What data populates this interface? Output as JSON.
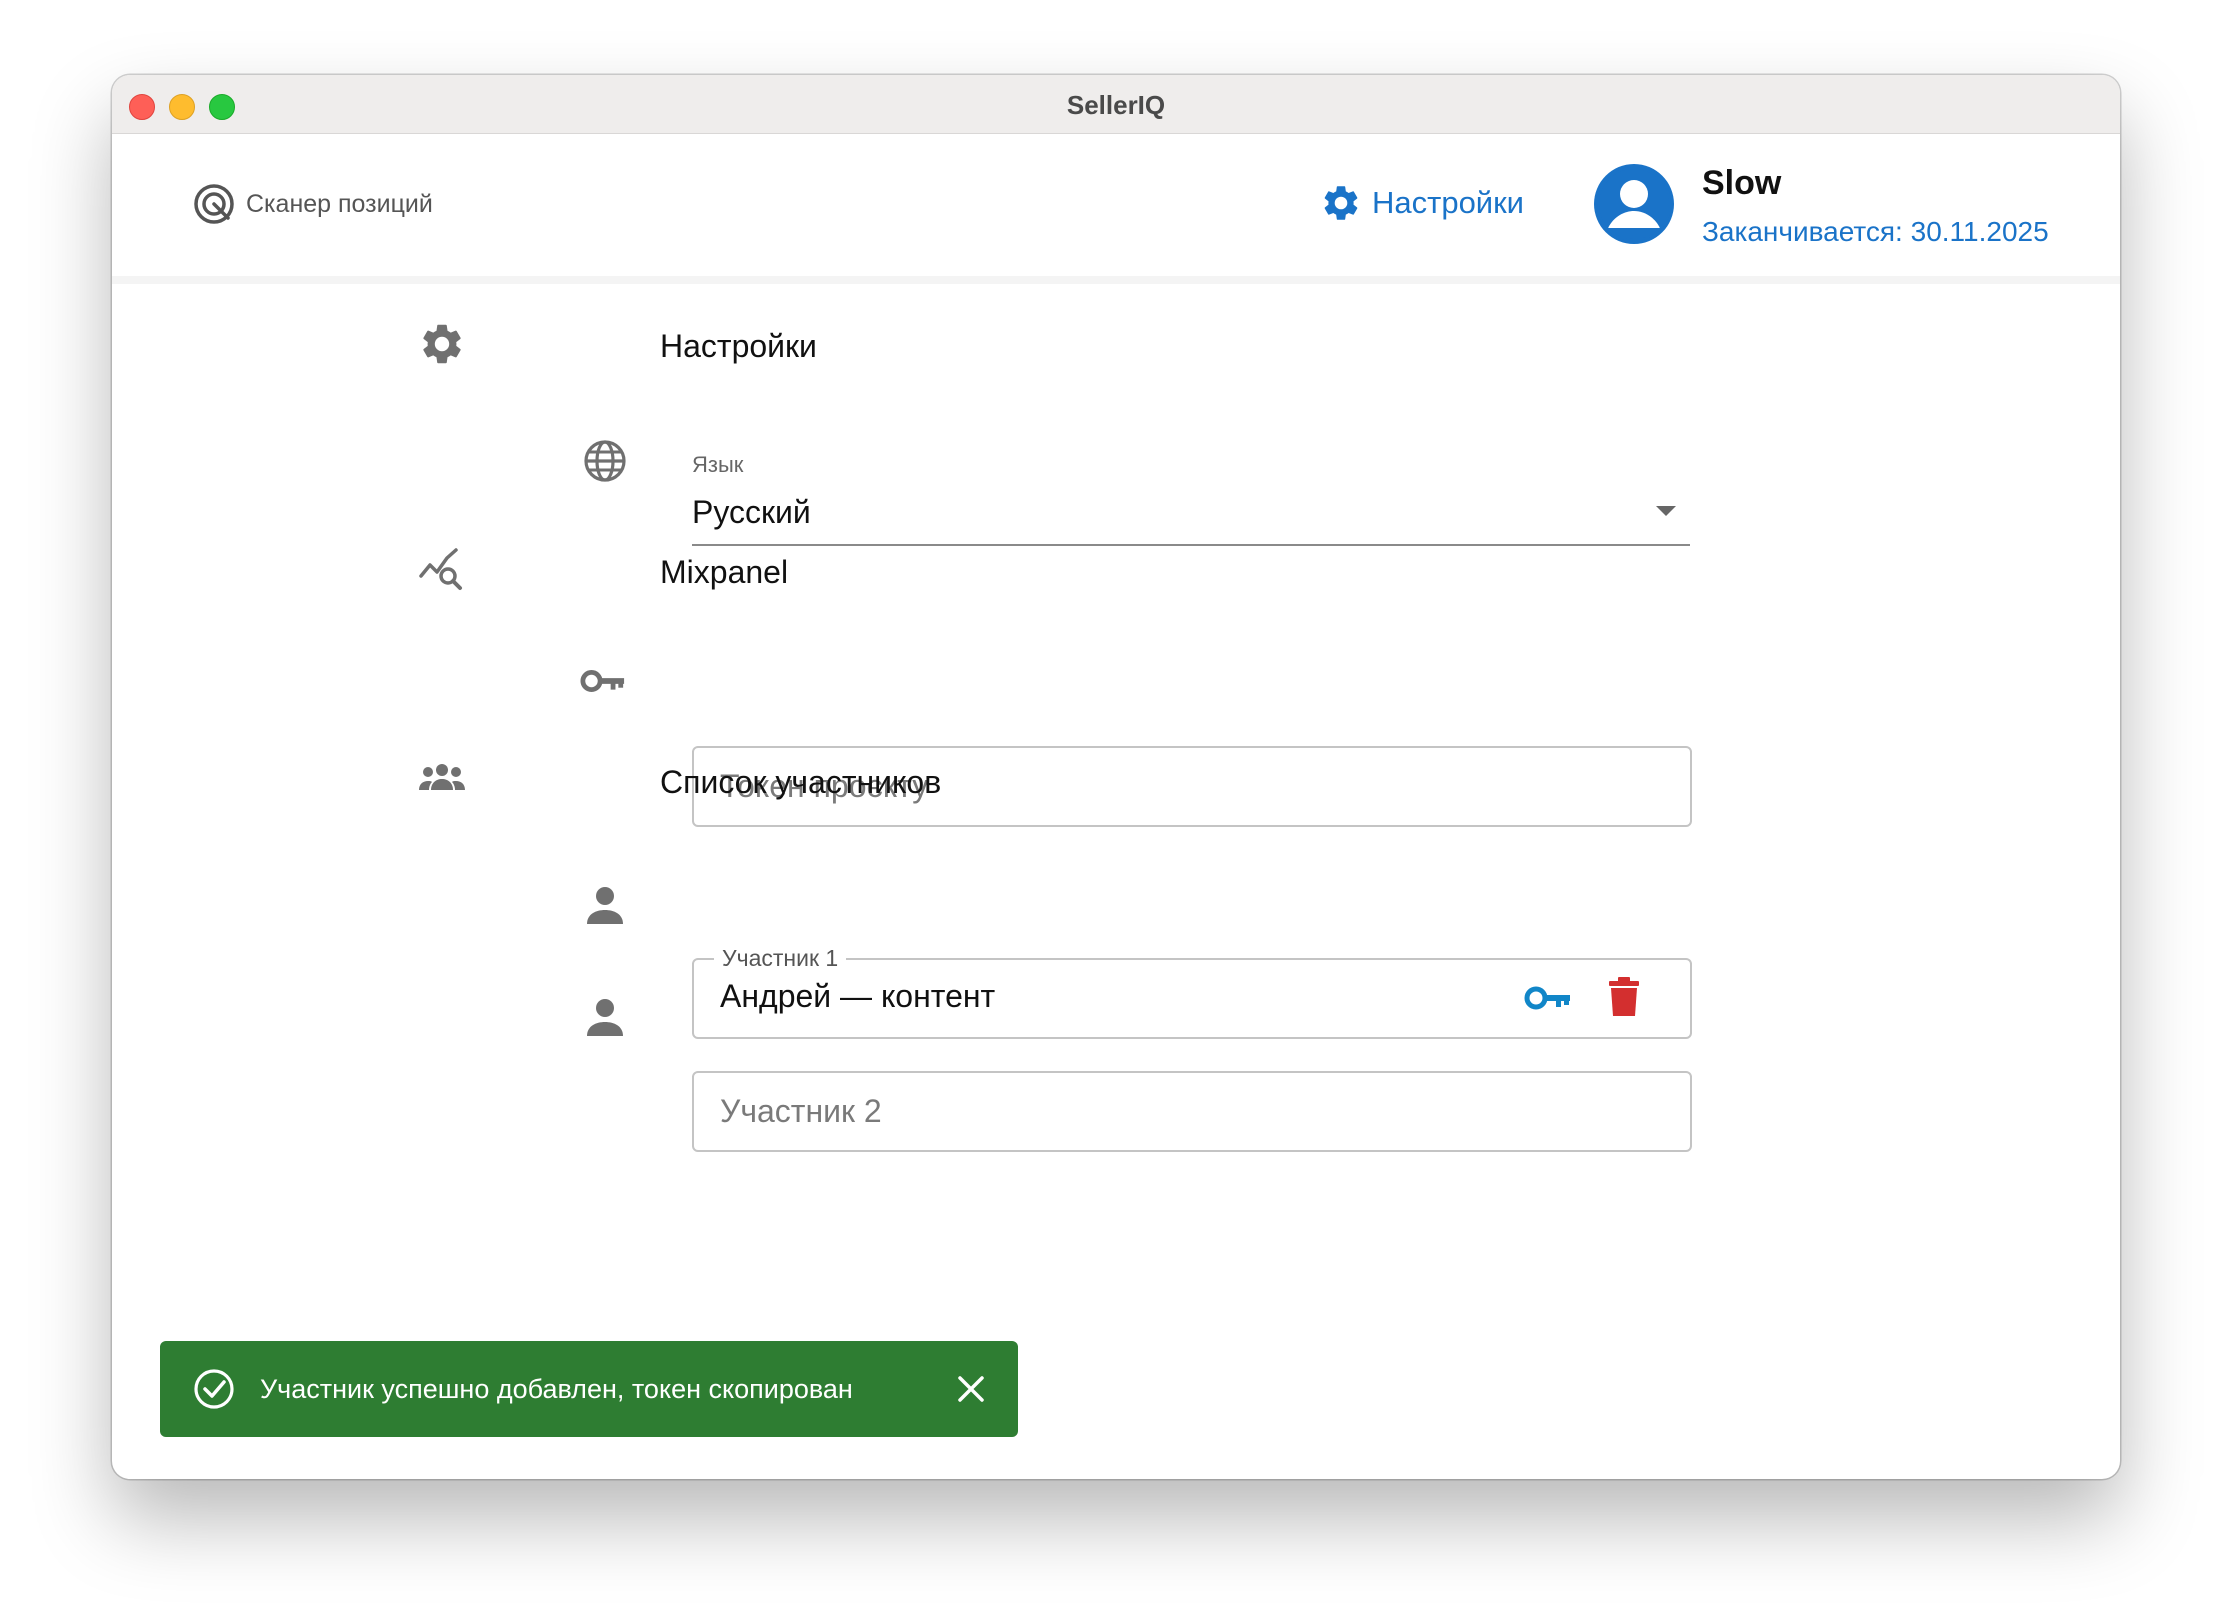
{
  "window": {
    "title": "SellerIQ"
  },
  "header": {
    "scanner_label": "Сканер позиций",
    "settings_label": "Настройки",
    "user_name": "Slow",
    "subscription": "Заканчивается: 30.11.2025"
  },
  "settings": {
    "title": "Настройки",
    "language": {
      "label": "Язык",
      "value": "Русский"
    }
  },
  "mixpanel": {
    "title": "Mixpanel",
    "token_placeholder": "Токен проєкту"
  },
  "members": {
    "title": "Список участников",
    "member1": {
      "legend": "Участник 1",
      "value": "Андрей — контент"
    },
    "member2": {
      "placeholder": "Участник 2"
    }
  },
  "toast": {
    "message": "Участник успешно добавлен, токен скопирован"
  },
  "colors": {
    "accent": "#1a73c8",
    "success": "#2e7d32",
    "danger": "#d32f2f",
    "key_icon": "#1186c8"
  },
  "icons": [
    "scanner-icon",
    "settings-gear-icon",
    "avatar-icon",
    "gear-icon",
    "globe-icon",
    "analytics-icon",
    "key-icon",
    "group-icon",
    "person-icon",
    "copy-key-icon",
    "trash-icon",
    "check-circle-icon",
    "close-icon"
  ]
}
